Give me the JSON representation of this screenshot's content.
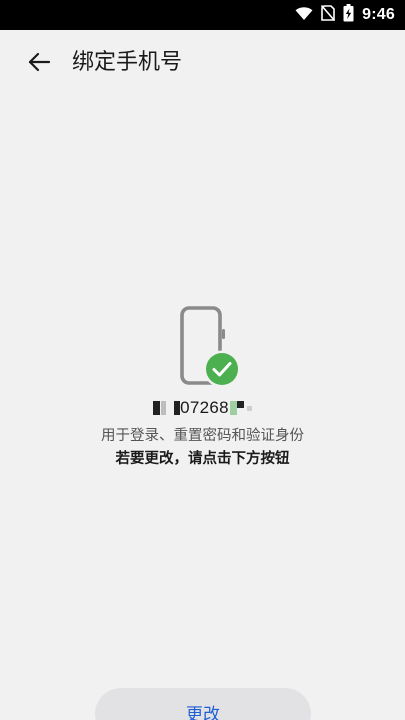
{
  "status_bar": {
    "time": "9:46",
    "icons": [
      "wifi-icon",
      "no-sim-icon",
      "battery-charging-icon"
    ]
  },
  "header": {
    "title": "绑定手机号",
    "back_icon": "arrow-left-icon"
  },
  "phone_info": {
    "masked_number": "07268",
    "status_icon": "check-circle-icon",
    "accent_color": "#4caf50",
    "description": "用于登录、重置密码和验证身份",
    "instruction": "若要更改，请点击下方按钮"
  },
  "actions": {
    "change_label": "更改",
    "link_color": "#1e5fd6"
  }
}
